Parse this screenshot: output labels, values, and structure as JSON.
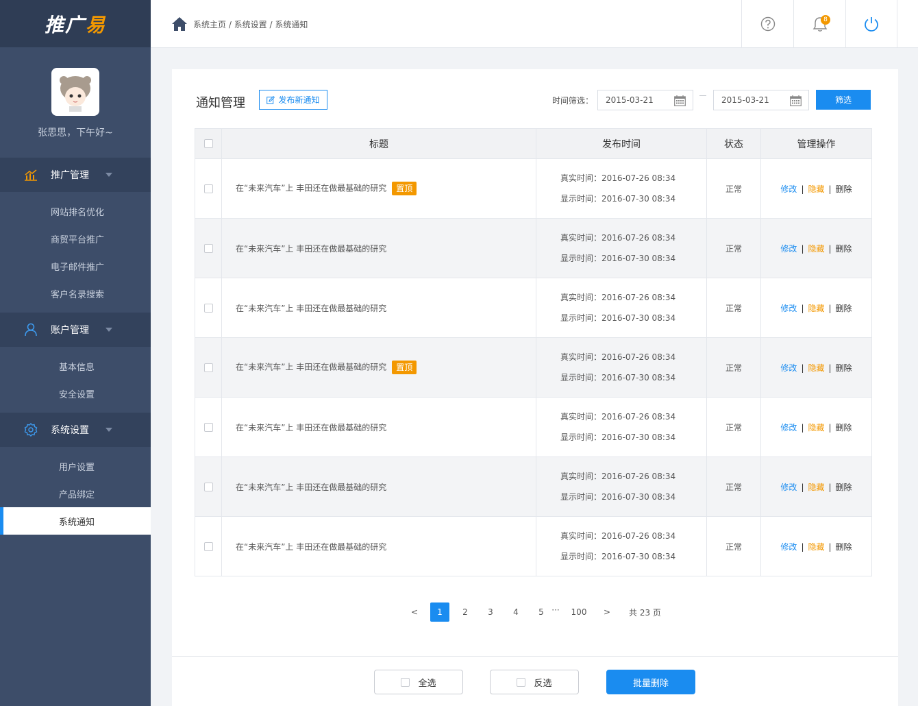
{
  "brand": {
    "logo_main": "推广",
    "logo_accent": "易"
  },
  "user": {
    "greeting": "张思思，下午好~"
  },
  "sidebar": {
    "groups": [
      {
        "title": "推广管理",
        "items": [
          "网站排名优化",
          "商贸平台推广",
          "电子邮件推广",
          "客户名录搜索"
        ]
      },
      {
        "title": "账户管理",
        "items": [
          "基本信息",
          "安全设置"
        ]
      },
      {
        "title": "系统设置",
        "items": [
          "用户设置",
          "产品绑定",
          "系统通知"
        ]
      }
    ],
    "active_item": "系统通知"
  },
  "header": {
    "breadcrumb": "系统主页 / 系统设置 / 系统通知",
    "notification_count": "8"
  },
  "main": {
    "title": "通知管理",
    "publish_label": "发布新通知",
    "filter_label": "时间筛选：",
    "date_from": "2015-03-21",
    "date_to": "2015-03-21",
    "filter_button": "筛选"
  },
  "table": {
    "columns": [
      "标题",
      "发布时间",
      "状态",
      "管理操作"
    ],
    "rows": [
      {
        "title": "在“未来汽车”上 丰田还在做最基础的研究",
        "pinned": true,
        "real_time": "真实时间：2016-07-26 08:34",
        "show_time": "显示时间：2016-07-30 08:34",
        "status": "正常"
      },
      {
        "title": "在“未来汽车”上 丰田还在做最基础的研究",
        "pinned": false,
        "real_time": "真实时间：2016-07-26 08:34",
        "show_time": "显示时间：2016-07-30 08:34",
        "status": "正常"
      },
      {
        "title": "在“未来汽车”上 丰田还在做最基础的研究",
        "pinned": false,
        "real_time": "真实时间：2016-07-26 08:34",
        "show_time": "显示时间：2016-07-30 08:34",
        "status": "正常"
      },
      {
        "title": "在“未来汽车”上 丰田还在做最基础的研究",
        "pinned": true,
        "real_time": "真实时间：2016-07-26 08:34",
        "show_time": "显示时间：2016-07-30 08:34",
        "status": "正常"
      },
      {
        "title": "在“未来汽车”上 丰田还在做最基础的研究",
        "pinned": false,
        "real_time": "真实时间：2016-07-26 08:34",
        "show_time": "显示时间：2016-07-30 08:34",
        "status": "正常"
      },
      {
        "title": "在“未来汽车”上 丰田还在做最基础的研究",
        "pinned": false,
        "real_time": "真实时间：2016-07-26 08:34",
        "show_time": "显示时间：2016-07-30 08:34",
        "status": "正常"
      },
      {
        "title": "在“未来汽车”上 丰田还在做最基础的研究",
        "pinned": false,
        "real_time": "真实时间：2016-07-26 08:34",
        "show_time": "显示时间：2016-07-30 08:34",
        "status": "正常"
      }
    ],
    "pinned_tag": "置顶",
    "ops": {
      "edit": "修改",
      "hide": "隐藏",
      "delete": "删除",
      "separator": "|"
    }
  },
  "pagination": {
    "prev": "<",
    "pages": [
      "1",
      "2",
      "3",
      "4",
      "5"
    ],
    "ellipsis": "···",
    "last": "100",
    "next": ">",
    "current": "1",
    "total": "共 23 页"
  },
  "footer": {
    "select_all": "全选",
    "invert": "反选",
    "batch_delete": "批量删除"
  },
  "colors": {
    "primary": "#1a8cf0",
    "accent": "#f39800",
    "sidebar": "#3d4d69",
    "sidebar_dark": "#33425c"
  }
}
